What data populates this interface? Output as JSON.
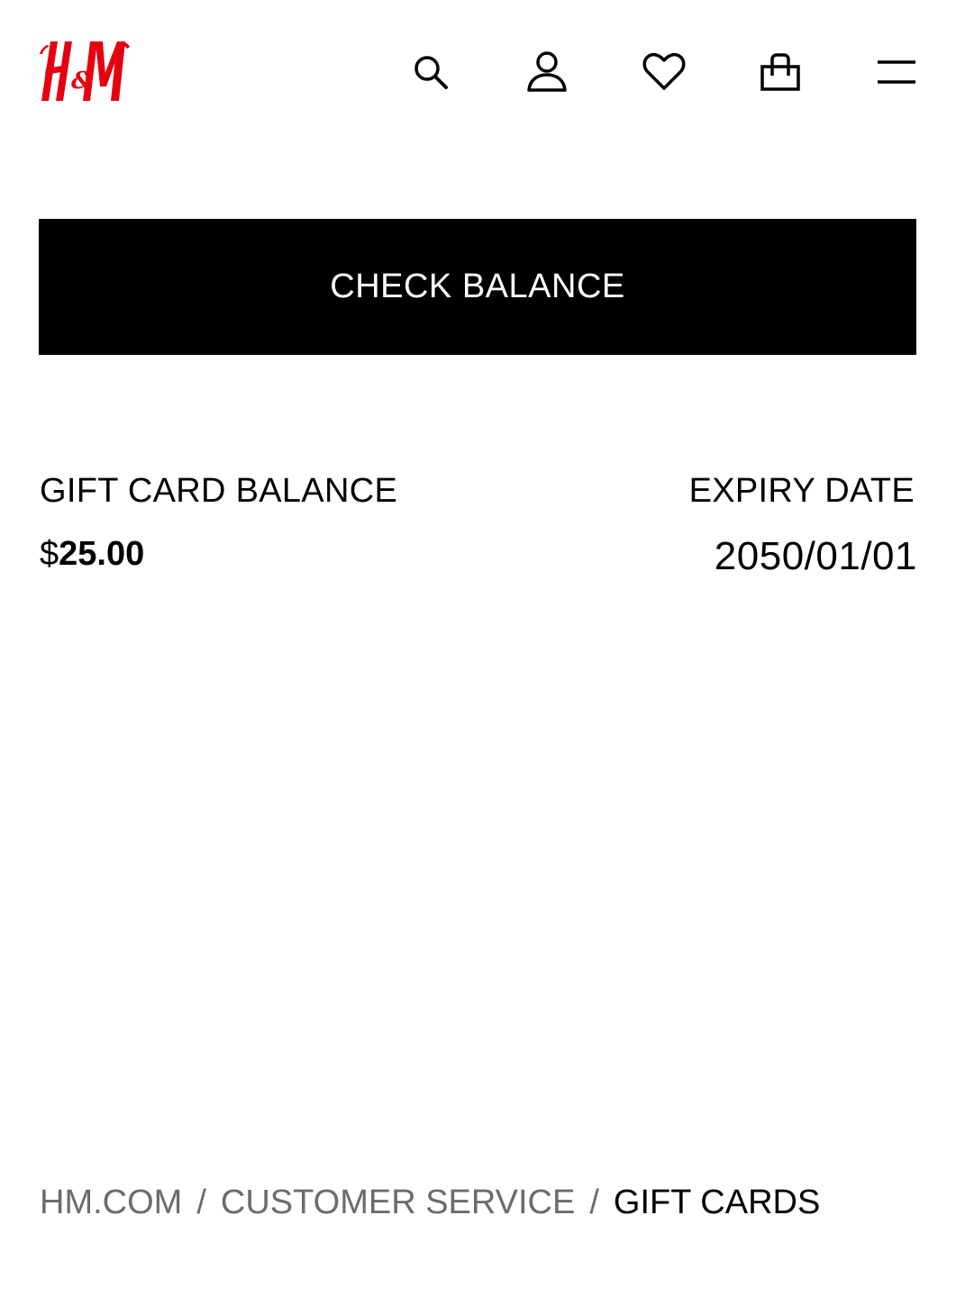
{
  "header": {
    "logo_text": "H&M",
    "brand_color": "#e50010",
    "icons": [
      "search-icon",
      "account-icon",
      "heart-icon",
      "shopping-bag-icon",
      "menu-icon"
    ]
  },
  "check_balance": {
    "label": "CHECK BALANCE"
  },
  "gift_card": {
    "balance_label": "GIFT CARD BALANCE",
    "currency_symbol": "$",
    "balance_amount": "25.00",
    "expiry_label": "EXPIRY DATE",
    "expiry_value": "2050/01/01"
  },
  "breadcrumb": {
    "items": [
      "HM.COM",
      "CUSTOMER SERVICE",
      "GIFT CARDS"
    ],
    "separator": "/"
  }
}
